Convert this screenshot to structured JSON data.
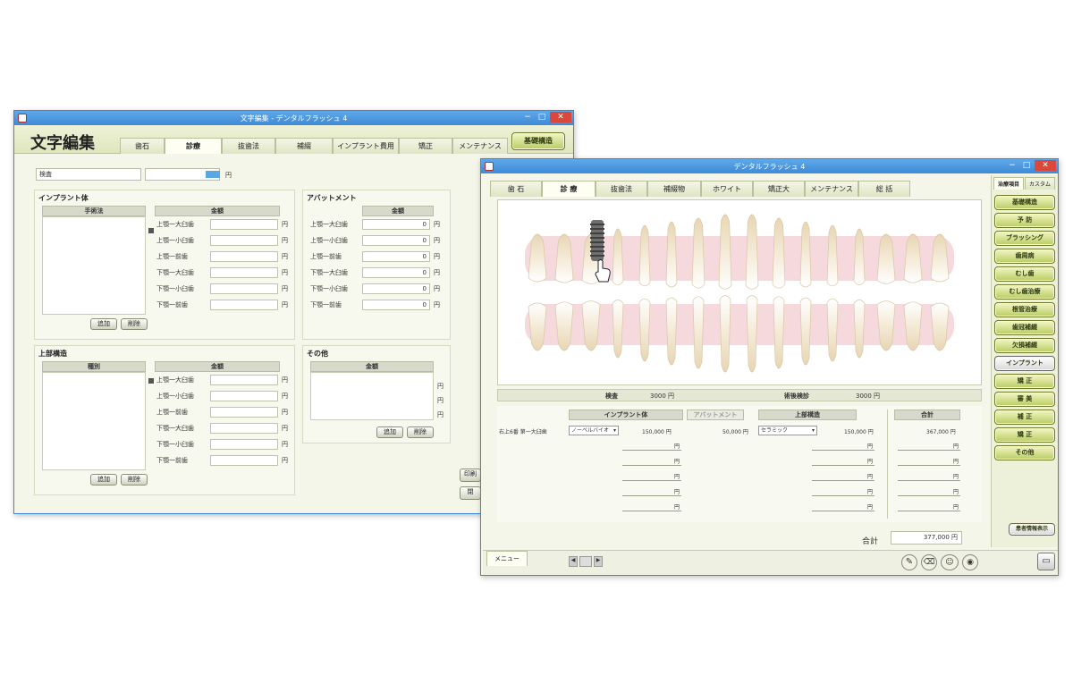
{
  "win1": {
    "title": "文字編集 - デンタルフラッシュ 4",
    "heading": "文字編集",
    "tabs": [
      "歯石",
      "診療",
      "抜歯法",
      "補綴",
      "インプラント費用",
      "矯正",
      "メンテナンス"
    ],
    "top_button": "基礎構造",
    "name_input": "検査",
    "yen": "円",
    "implant": {
      "title": "インプラント体",
      "left_header": "手術法",
      "right_header": "金額",
      "rows": [
        "上顎一大臼歯",
        "上顎一小臼歯",
        "上顎一前歯",
        "下顎一大臼歯",
        "下顎一小臼歯",
        "下顎一前歯"
      ],
      "add": "追加",
      "delete": "削除"
    },
    "abutment": {
      "title": "アバットメント",
      "header": "金額",
      "rows": [
        "上顎一大臼歯",
        "上顎一小臼歯",
        "上顎一前歯",
        "下顎一大臼歯",
        "下顎一小臼歯",
        "下顎一前歯"
      ],
      "values": [
        "0",
        "0",
        "0",
        "0",
        "0",
        "0"
      ]
    },
    "superstructure": {
      "title": "上部構造",
      "left_header": "種別",
      "right_header": "金額",
      "rows": [
        "上顎一大臼歯",
        "上顎一小臼歯",
        "上顎一前歯",
        "下顎一大臼歯",
        "下顎一小臼歯",
        "下顎一前歯"
      ],
      "add": "追加",
      "delete": "削除"
    },
    "other": {
      "title": "その他",
      "header": "金額",
      "add": "追加",
      "delete": "削除"
    },
    "side_buttons": [
      "印刷",
      "閉"
    ]
  },
  "win2": {
    "title": "デンタルフラッシュ 4",
    "tabs": [
      "歯 石",
      "診 療",
      "抜歯法",
      "補綴物",
      "ホワイト",
      "矯正大",
      "メンテナンス",
      "総 括"
    ],
    "side_tabs": [
      "治療項目",
      "カスタム"
    ],
    "side_buttons": [
      "基礎構造",
      "予 防",
      "ブラッシング",
      "歯周病",
      "むし歯",
      "むし歯治療",
      "根管治療",
      "歯冠補綴",
      "欠損補綴",
      "インプラント",
      "矯 正",
      "審 美",
      "補 正",
      "矯 正",
      "その他"
    ],
    "side_active": 9,
    "bottom_side_button": "患者情報表示",
    "exam_label": "検査",
    "exam_value": "3000 円",
    "diag_label": "術後検診",
    "diag_value": "3000 円",
    "table": {
      "col1": "インプラント体",
      "col2": "アバットメント",
      "col3": "上部構造",
      "col4": "合計",
      "row_label": "右上6番 第一大臼歯",
      "sel1": "ノーベルバイオ",
      "val1": "150,000 円",
      "val2": "50,000 円",
      "sel2": "セラミック",
      "val3": "150,000 円",
      "val4": "367,000 円",
      "yen": "円"
    },
    "total_label": "合計",
    "total_value": "377,000 円",
    "menu_tab": "メニュー",
    "colors": {
      "titlebar": "#3e8ad7",
      "green_button": "#b9cc63",
      "panel": "#f4f6ea"
    }
  }
}
